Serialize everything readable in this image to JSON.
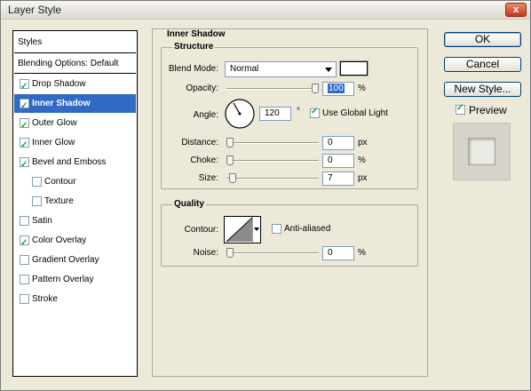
{
  "window": {
    "title": "Layer Style",
    "close_glyph": "x"
  },
  "styles_list": {
    "header": "Styles",
    "blending_options": "Blending Options: Default",
    "items": [
      {
        "label": "Drop Shadow",
        "checked": true,
        "selected": false,
        "indent": false
      },
      {
        "label": "Inner Shadow",
        "checked": true,
        "selected": true,
        "indent": false
      },
      {
        "label": "Outer Glow",
        "checked": true,
        "selected": false,
        "indent": false
      },
      {
        "label": "Inner Glow",
        "checked": true,
        "selected": false,
        "indent": false
      },
      {
        "label": "Bevel and Emboss",
        "checked": true,
        "selected": false,
        "indent": false
      },
      {
        "label": "Contour",
        "checked": false,
        "selected": false,
        "indent": true
      },
      {
        "label": "Texture",
        "checked": false,
        "selected": false,
        "indent": true
      },
      {
        "label": "Satin",
        "checked": false,
        "selected": false,
        "indent": false
      },
      {
        "label": "Color Overlay",
        "checked": true,
        "selected": false,
        "indent": false
      },
      {
        "label": "Gradient Overlay",
        "checked": false,
        "selected": false,
        "indent": false
      },
      {
        "label": "Pattern Overlay",
        "checked": false,
        "selected": false,
        "indent": false
      },
      {
        "label": "Stroke",
        "checked": false,
        "selected": false,
        "indent": false
      }
    ]
  },
  "inner_shadow": {
    "title": "Inner Shadow",
    "structure": {
      "title": "Structure",
      "blend_mode": {
        "label": "Blend Mode:",
        "value": "Normal",
        "swatch_color": "#ffffff"
      },
      "opacity": {
        "label": "Opacity:",
        "value": "100",
        "unit": "%",
        "level": 1.0
      },
      "angle": {
        "label": "Angle:",
        "value": "120",
        "unit": "°",
        "use_global_light": true,
        "global_light_label": "Use Global Light"
      },
      "distance": {
        "label": "Distance:",
        "value": "0",
        "unit": "px",
        "level": 0.0
      },
      "choke": {
        "label": "Choke:",
        "value": "0",
        "unit": "%",
        "level": 0.0
      },
      "size": {
        "label": "Size:",
        "value": "7",
        "unit": "px",
        "level": 0.03
      }
    },
    "quality": {
      "title": "Quality",
      "contour": {
        "label": "Contour:",
        "anti_aliased": false,
        "anti_aliased_label": "Anti-aliased"
      },
      "noise": {
        "label": "Noise:",
        "value": "0",
        "unit": "%",
        "level": 0.0
      }
    }
  },
  "buttons": {
    "ok": "OK",
    "cancel": "Cancel",
    "new_style": "New Style..."
  },
  "preview": {
    "label": "Preview",
    "checked": true
  }
}
